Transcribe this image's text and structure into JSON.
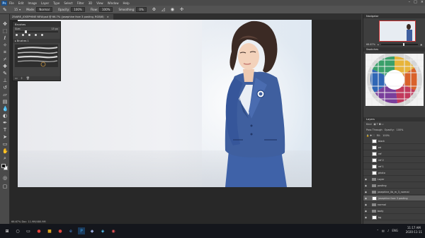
{
  "menu": {
    "logo": "Ps",
    "items": [
      "File",
      "Edit",
      "Image",
      "Layer",
      "Type",
      "Select",
      "Filter",
      "3D",
      "View",
      "Window",
      "Help"
    ]
  },
  "options": {
    "brush_size": "15",
    "mode_label": "Mode:",
    "mode_value": "Normal",
    "opacity_label": "Opacity:",
    "opacity_value": "100%",
    "flow_label": "Flow:",
    "flow_value": "100%",
    "smoothing_label": "Smoothing:",
    "smoothing_value": "0%"
  },
  "document_tab": {
    "title": "ZIVARE_JOSEPHINE NEW.psd @ 66.7% (josephine face 3 posting, RGB/8)",
    "close": "×"
  },
  "brushes_panel": {
    "title": "Brushes",
    "size_label": "Size:",
    "size_value": "15 px",
    "folder": "Brushes 1"
  },
  "navigator": {
    "tab": "Navigator",
    "zoom": "66.67%"
  },
  "swatches": {
    "tab": "Swatches"
  },
  "layers_panel": {
    "tab": "Layers",
    "kind": "Kind",
    "blend": "Pass Through",
    "opacity_label": "Opacity:",
    "opacity_value": "100%",
    "fill_label": "Fill:",
    "fill_value": "100%",
    "items": [
      "black",
      "ed",
      "ref",
      "ref 2",
      "ref 1",
      "photo",
      "Layer",
      "posting",
      "josephine_lib_m_3_normal",
      "josephine face 3 posting",
      "normal",
      "body",
      "bg"
    ]
  },
  "status_bar": {
    "text": "66.67%   Doc: 11.9M/480.9M"
  },
  "taskbar": {
    "time": "11:17 AM",
    "date": "2020-11-11",
    "lang": "ENG"
  }
}
